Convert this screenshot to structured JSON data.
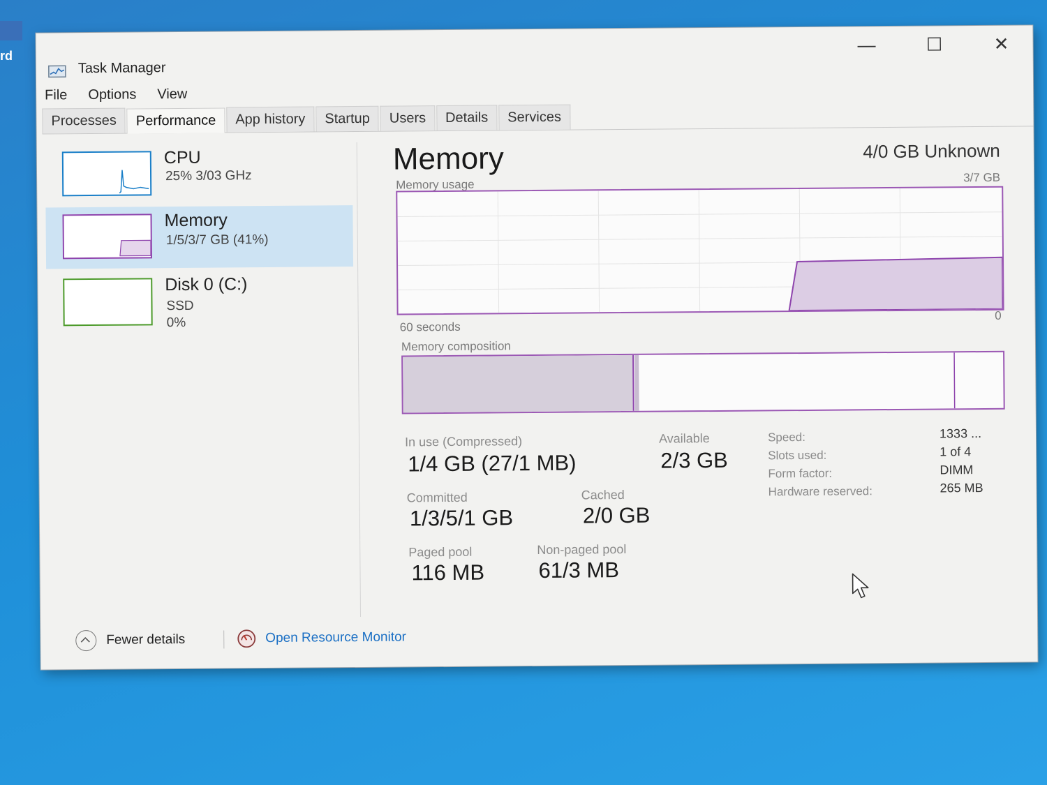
{
  "window": {
    "title": "Task Manager",
    "controls": {
      "minimize": "—",
      "maximize": "☐",
      "close": "✕"
    }
  },
  "menu": [
    "File",
    "Options",
    "View"
  ],
  "tabs": [
    "Processes",
    "Performance",
    "App history",
    "Startup",
    "Users",
    "Details",
    "Services"
  ],
  "active_tab": "Performance",
  "sidebar": {
    "items": [
      {
        "name": "CPU",
        "sub1": "25%  3/03 GHz",
        "sub2": "",
        "color": "#1a7fc8"
      },
      {
        "name": "Memory",
        "sub1": "1/5/3/7 GB (41%)",
        "sub2": "",
        "color": "#8e44ad"
      },
      {
        "name": "Disk 0 (C:)",
        "sub1": "SSD",
        "sub2": "0%",
        "color": "#4c9a2a"
      }
    ]
  },
  "memory": {
    "title": "Memory",
    "total": "4/0 GB Unknown",
    "usage_label": "Memory usage",
    "usage_max": "3/7 GB",
    "time_span": "60 seconds",
    "zero": "0",
    "composition_label": "Memory composition",
    "stats": {
      "in_use_label": "In use (Compressed)",
      "in_use_value": "1/4 GB (27/1 MB)",
      "available_label": "Available",
      "available_value": "2/3 GB",
      "committed_label": "Committed",
      "committed_value": "1/3/5/1 GB",
      "cached_label": "Cached",
      "cached_value": "2/0 GB",
      "paged_label": "Paged pool",
      "paged_value": "116 MB",
      "nonpaged_label": "Non-paged pool",
      "nonpaged_value": "61/3 MB"
    },
    "details": {
      "speed_label": "Speed:",
      "speed_value": "1333 ...",
      "slots_label": "Slots used:",
      "slots_value": "1 of 4",
      "form_label": "Form factor:",
      "form_value": "DIMM",
      "hw_label": "Hardware reserved:",
      "hw_value": "265 MB"
    }
  },
  "footer": {
    "fewer_details": "Fewer details",
    "resource_monitor": "Open Resource Monitor"
  },
  "desktop": {
    "edge_text": "rd"
  }
}
